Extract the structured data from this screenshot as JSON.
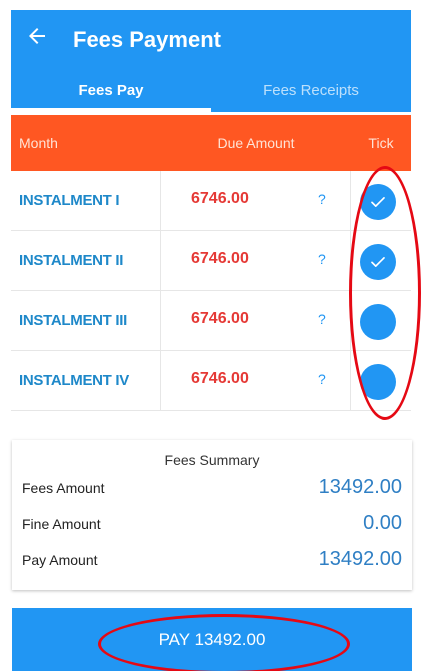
{
  "appbar": {
    "title": "Fees Payment",
    "back_icon": "arrow-left-icon"
  },
  "tabs": [
    {
      "label": "Fees Pay",
      "active": true
    },
    {
      "label": "Fees Receipts",
      "active": false
    }
  ],
  "table": {
    "headers": [
      "Month",
      "Due Amount",
      "Tick"
    ],
    "rows": [
      {
        "month": "INSTALMENT I",
        "amount": "6746.00",
        "info": "?",
        "checked": true
      },
      {
        "month": "INSTALMENT II",
        "amount": "6746.00",
        "info": "?",
        "checked": true
      },
      {
        "month": "INSTALMENT III",
        "amount": "6746.00",
        "info": "?",
        "checked": false
      },
      {
        "month": "INSTALMENT IV",
        "amount": "6746.00",
        "info": "?",
        "checked": false
      }
    ]
  },
  "summary": {
    "title": "Fees Summary",
    "fees_label": "Fees Amount",
    "fees_value": "13492.00",
    "fine_label": "Fine Amount",
    "fine_value": "0.00",
    "pay_label": "Pay Amount",
    "pay_value": "13492.00"
  },
  "pay_button": {
    "label": "PAY 13492.00"
  },
  "colors": {
    "primary": "#2196f3",
    "header_orange": "#ff5722",
    "amount_red": "#e53935",
    "annotation_red": "#e50914"
  }
}
